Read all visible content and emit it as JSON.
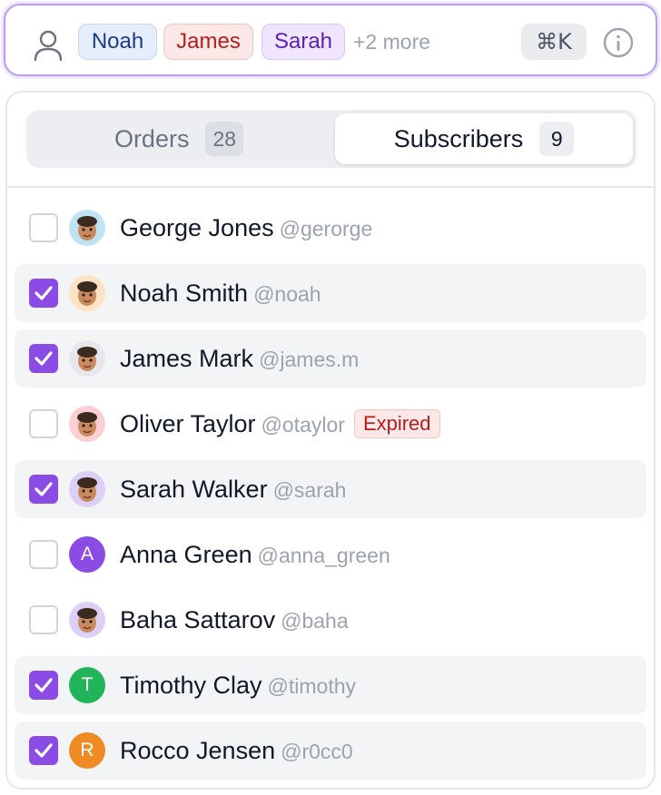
{
  "search": {
    "chips": [
      "Noah",
      "James",
      "Sarah"
    ],
    "more": "+2 more",
    "shortcut": "⌘K"
  },
  "tabs": [
    {
      "label": "Orders",
      "count": "28",
      "active": false
    },
    {
      "label": "Subscribers",
      "count": "9",
      "active": true
    }
  ],
  "colors": {
    "accent": "#8b4ce6",
    "chip_blue": "#e6eefc",
    "chip_red": "#fde8e8",
    "chip_purple": "#efe6fd",
    "expired": "#b91c1c"
  },
  "subscribers": [
    {
      "name": "George Jones",
      "handle": "@gerorge",
      "checked": false,
      "avatar": "memoji-hat-icon",
      "avatar_bg": "#bfe3f5"
    },
    {
      "name": "Noah Smith",
      "handle": "@noah",
      "checked": true,
      "avatar": "memoji-curly-icon",
      "avatar_bg": "#fde2c4"
    },
    {
      "name": "James Mark",
      "handle": "@james.m",
      "checked": true,
      "avatar": "memoji-redcap-icon",
      "avatar_bg": "#e5e7eb"
    },
    {
      "name": "Oliver Taylor",
      "handle": "@otaylor",
      "checked": false,
      "badge": "Expired",
      "avatar": "memoji-man-icon",
      "avatar_bg": "#fbcfd4"
    },
    {
      "name": "Sarah Walker",
      "handle": "@sarah",
      "checked": true,
      "avatar": "memoji-hijab-icon",
      "avatar_bg": "#ddd0f7"
    },
    {
      "name": "Anna Green",
      "handle": "@anna_green",
      "checked": false,
      "letter": "A",
      "avatar_bg": "#8b4ce6"
    },
    {
      "name": "Baha Sattarov",
      "handle": "@baha",
      "checked": false,
      "avatar": "memoji-bald-icon",
      "avatar_bg": "#ddd0f7"
    },
    {
      "name": "Timothy Clay",
      "handle": "@timothy",
      "checked": true,
      "letter": "T",
      "avatar_bg": "#22b45a"
    },
    {
      "name": "Rocco Jensen",
      "handle": "@r0cc0",
      "checked": true,
      "letter": "R",
      "avatar_bg": "#f08a24"
    }
  ]
}
